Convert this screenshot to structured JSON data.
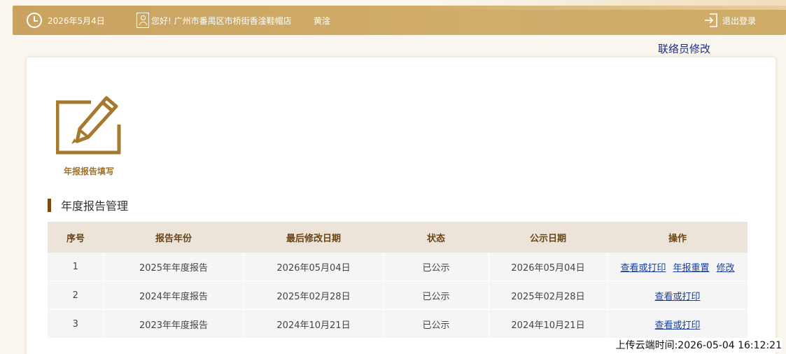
{
  "header": {
    "date": "2026年5月4日",
    "greeting": "您好!  广州市番禺区市桥街香淦鞋帽店",
    "username": "黄淦",
    "logout_label": "退出登录"
  },
  "contact_link": "联络员修改",
  "report_tile_label": "年报报告填写",
  "section_title": "年度报告管理",
  "table": {
    "headers": [
      "序号",
      "报告年份",
      "最后修改日期",
      "状态",
      "公示日期",
      "操作"
    ],
    "rows": [
      {
        "index": "1",
        "year": "2025年年度报告",
        "modified": "2026年05月04日",
        "status": "已公示",
        "published": "2026年05月04日",
        "actions": [
          "查看或打印",
          "年报重置",
          "修改"
        ]
      },
      {
        "index": "2",
        "year": "2024年年度报告",
        "modified": "2025年02月28日",
        "status": "已公示",
        "published": "2025年02月28日",
        "actions": [
          "查看或打印"
        ]
      },
      {
        "index": "3",
        "year": "2023年年度报告",
        "modified": "2024年10月21日",
        "status": "已公示",
        "published": "2024年10月21日",
        "actions": [
          "查看或打印"
        ]
      }
    ]
  },
  "upload_time": "上传云端时间:2026-05-04 16:12:21",
  "colors": {
    "header_bg": "#cfa963",
    "accent_brown": "#7a4a10",
    "link_blue": "#1a3fa0"
  }
}
